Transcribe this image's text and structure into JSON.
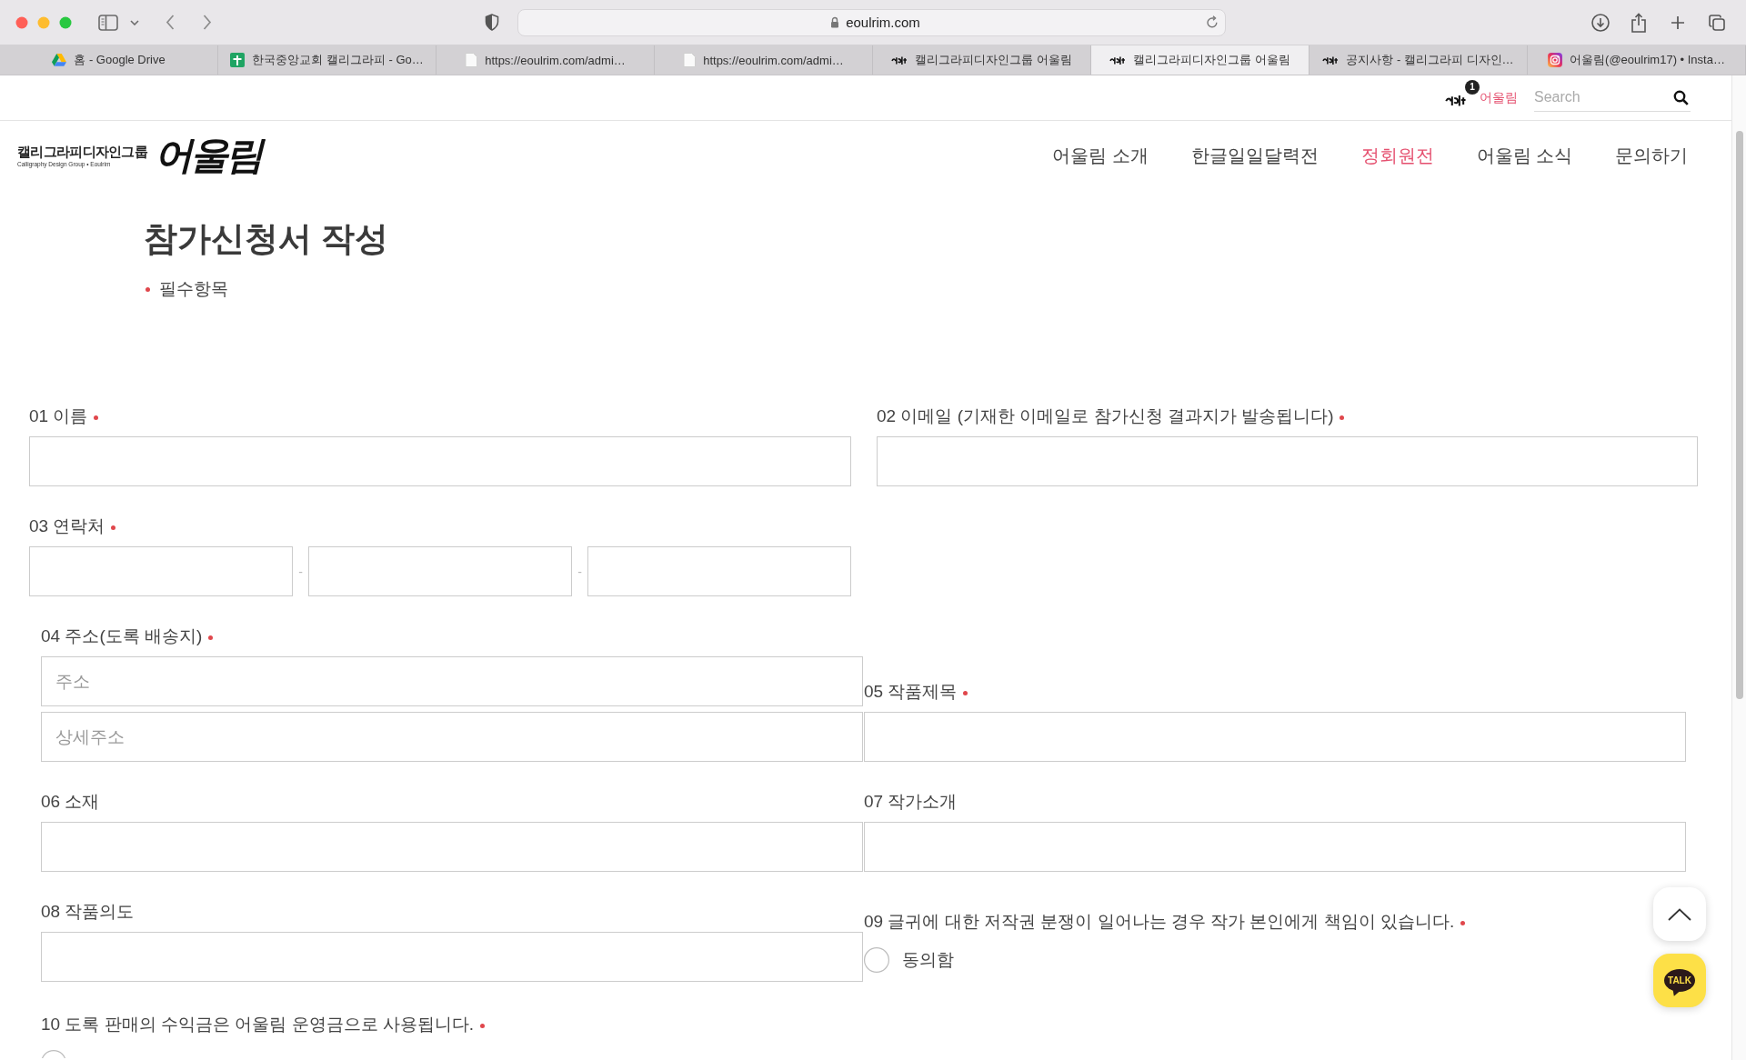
{
  "browser": {
    "address": "eoulrim.com",
    "tabs": [
      {
        "title": "홈 - Google Drive",
        "kind": "drive",
        "selected": false
      },
      {
        "title": "한국중앙교회 캘리그라피 - Go…",
        "kind": "sheets",
        "selected": false
      },
      {
        "title": "https://eoulrim.com/admi…",
        "kind": "page",
        "selected": false
      },
      {
        "title": "https://eoulrim.com/admi…",
        "kind": "page",
        "selected": false
      },
      {
        "title": "캘리그라피디자인그룹 어울림",
        "kind": "site",
        "selected": false
      },
      {
        "title": "캘리그라피디자인그룹 어울림",
        "kind": "site",
        "selected": true
      },
      {
        "title": "공지사항 - 캘리그라피 디자인…",
        "kind": "site",
        "selected": false
      },
      {
        "title": "어울림(@eoulrim17) • Insta…",
        "kind": "instagram",
        "selected": false
      }
    ]
  },
  "site": {
    "topbar": {
      "badge": "1",
      "account": "어울림",
      "search": {
        "placeholder": "Search"
      }
    },
    "logo": {
      "name": "캘리그라피디자인그룹",
      "tagline": "Calligraphy Design Group • Eoulrim",
      "mark": "어울림"
    },
    "nav": [
      {
        "label": "어울림 소개",
        "selected": false
      },
      {
        "label": "한글일일달력전",
        "selected": false
      },
      {
        "label": "정회원전",
        "selected": true
      },
      {
        "label": "어울림 소식",
        "selected": false
      },
      {
        "label": "문의하기",
        "selected": false
      }
    ]
  },
  "page": {
    "title": "참가신청서 작성",
    "required_note": "필수항목"
  },
  "form": {
    "sections": [
      {
        "fields": [
          {
            "label": "01 이름",
            "required": true,
            "kind": "text"
          },
          {
            "label": "02 이메일 (기재한 이메일로 참가신청 결과지가 발송됩니다)",
            "required": true,
            "kind": "text"
          },
          {
            "label": "03 연락처",
            "required": true,
            "kind": "phone",
            "separators": [
              "-",
              "-"
            ]
          }
        ]
      },
      {
        "fields": [
          {
            "label": "04 주소(도록 배송지)",
            "required": true,
            "kind": "address",
            "inputs": [
              {
                "placeholder": "주소"
              },
              {
                "placeholder": "상세주소"
              }
            ]
          },
          {
            "label": "05 작품제목",
            "required": true,
            "kind": "text"
          },
          {
            "label": "06 소재",
            "required": false,
            "kind": "text"
          },
          {
            "label": "07 작가소개",
            "required": false,
            "kind": "text"
          },
          {
            "label": "08 작품의도",
            "required": false,
            "kind": "text"
          },
          {
            "label": "09 글귀에 대한 저작권 분쟁이 일어나는 경우 작가 본인에게 책임이 있습니다.",
            "required": true,
            "kind": "agree",
            "options": [
              {
                "label": "동의함",
                "selected": false
              }
            ]
          },
          {
            "label": "10 도록 판매의 수익금은 어울림 운영금으로 사용됩니다.",
            "required": true,
            "kind": "agree",
            "options": [
              {
                "selected": false
              }
            ]
          }
        ]
      }
    ]
  },
  "floating": {
    "talk": "TALK"
  }
}
